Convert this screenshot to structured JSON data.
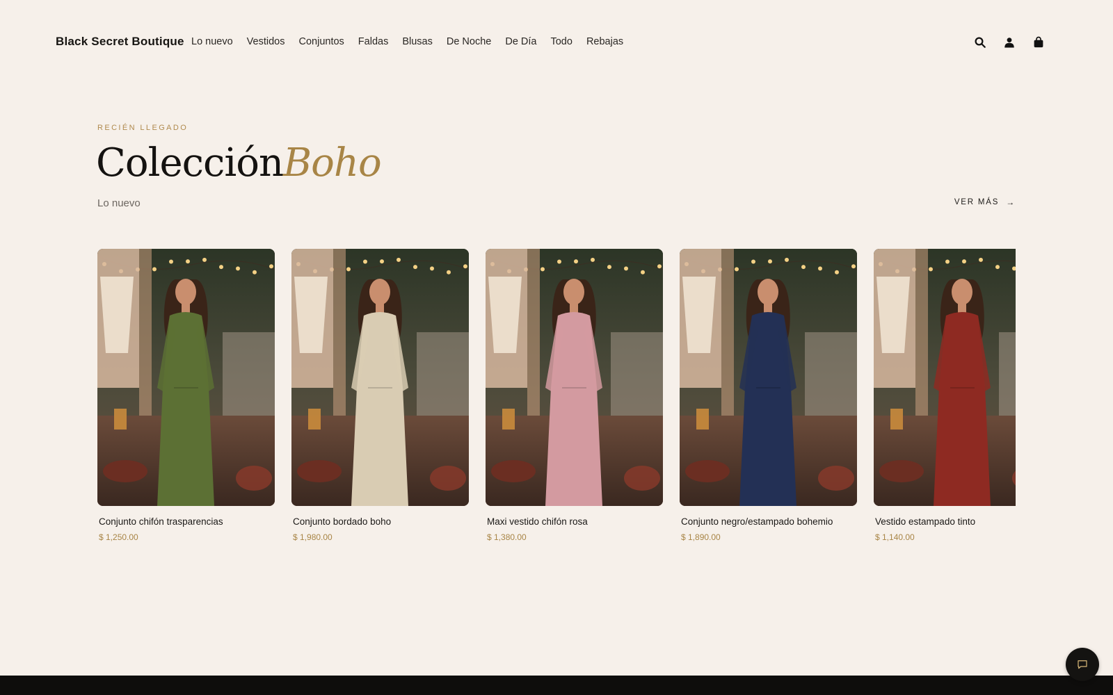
{
  "header": {
    "brand": "Black Secret Boutique",
    "nav": [
      "Lo nuevo",
      "Vestidos",
      "Conjuntos",
      "Faldas",
      "Blusas",
      "De Noche",
      "De Día",
      "Todo",
      "Rebajas"
    ],
    "icons": [
      "search-icon",
      "user-icon",
      "shopping-bag-icon"
    ]
  },
  "hero": {
    "eyebrow": "RECIÉN LLEGADO",
    "title_main": "Colección",
    "title_accent": "Boho",
    "subtitle": "Lo nuevo",
    "cta": "VER MÁS"
  },
  "products": [
    {
      "name": "Conjunto chifón trasparencias",
      "price": "$ 1,250.00",
      "color": "#5c7034"
    },
    {
      "name": "Conjunto bordado boho",
      "price": "$ 1,980.00",
      "color": "#d9ccb3"
    },
    {
      "name": "Maxi vestido chifón rosa",
      "price": "$ 1,380.00",
      "color": "#d39aa0"
    },
    {
      "name": "Conjunto negro/estampado bohemio",
      "price": "$ 1,890.00",
      "color": "#233055"
    },
    {
      "name": "Vestido estampado tinto",
      "price": "$ 1,140.00",
      "color": "#8e2a22"
    }
  ],
  "colors": {
    "background": "#f6f0ea",
    "accent": "#a88546",
    "text": "#1c1a18"
  },
  "chat": {
    "icon": "chat-icon"
  }
}
